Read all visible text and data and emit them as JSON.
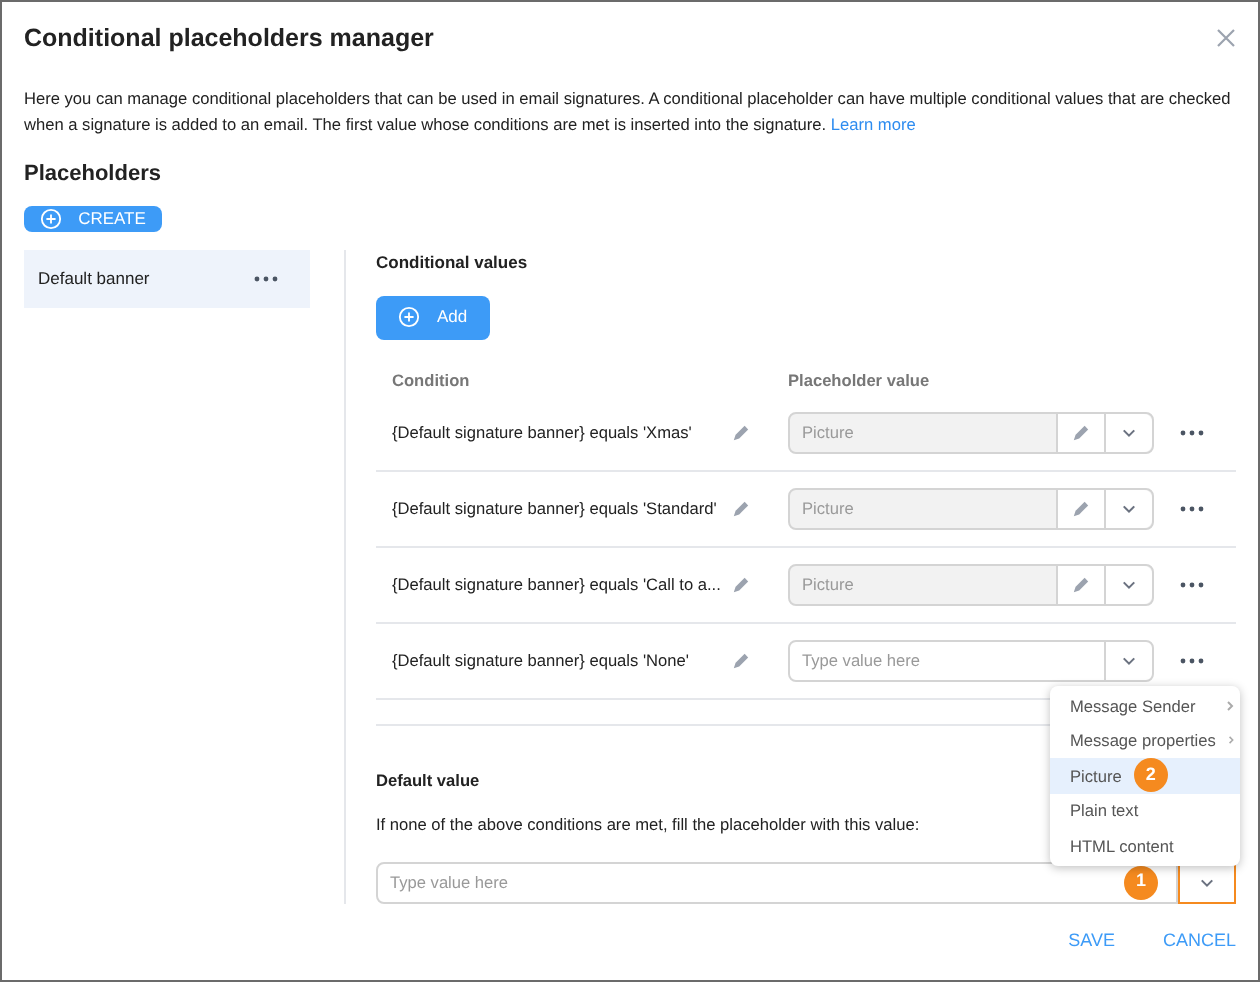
{
  "dialog": {
    "title": "Conditional placeholders manager",
    "description": "Here you can manage conditional placeholders that can be used in email signatures. A conditional placeholder can have multiple conditional values that are checked when a signature is added to an email. The first value whose conditions are met is inserted into the signature.",
    "learn_more": "Learn more"
  },
  "placeholders": {
    "heading": "Placeholders",
    "create_button": "CREATE",
    "items": [
      {
        "name": "Default banner",
        "selected": true
      }
    ]
  },
  "conditional_values": {
    "heading": "Conditional values",
    "add_button": "Add",
    "columns": [
      "Condition",
      "Placeholder value"
    ],
    "rows": [
      {
        "condition": "{Default signature banner} equals 'Xmas'",
        "value": "Picture"
      },
      {
        "condition": "{Default signature banner} equals 'Standard'",
        "value": "Picture"
      },
      {
        "condition": "{Default signature banner} equals 'Call to a...",
        "value": "Picture"
      },
      {
        "condition": "{Default signature banner} equals 'None'",
        "placeholder": "Type value here"
      }
    ]
  },
  "default_value": {
    "heading": "Default value",
    "hint": "If none of the above conditions are met, fill the placeholder with this value:",
    "placeholder": "Type value here",
    "dropdown_focused": true,
    "step_badge": "1"
  },
  "menu": {
    "items": [
      {
        "label": "Message Sender",
        "submenu": true,
        "selected": false
      },
      {
        "label": "Message properties",
        "submenu": true,
        "selected": false
      },
      {
        "label": "Picture",
        "submenu": false,
        "selected": true,
        "step_badge": "2"
      },
      {
        "label": "Plain text",
        "submenu": false,
        "selected": false
      },
      {
        "label": "HTML content",
        "submenu": false,
        "selected": false
      }
    ]
  },
  "footer": {
    "buttons": [
      "SAVE",
      "CANCEL"
    ]
  }
}
